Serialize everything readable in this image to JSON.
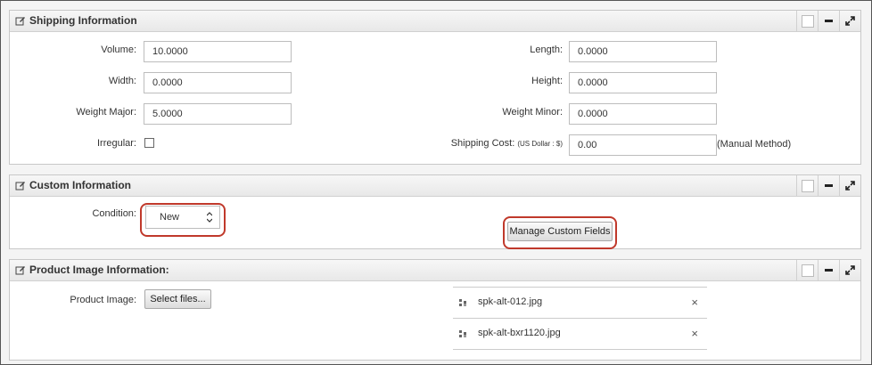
{
  "shipping": {
    "title": "Shipping Information",
    "volume": {
      "label": "Volume:",
      "value": "10.0000"
    },
    "width": {
      "label": "Width:",
      "value": "0.0000"
    },
    "weight_major": {
      "label": "Weight Major:",
      "value": "5.0000"
    },
    "irregular": {
      "label": "Irregular:"
    },
    "length": {
      "label": "Length:",
      "value": "0.0000"
    },
    "height": {
      "label": "Height:",
      "value": "0.0000"
    },
    "weight_minor": {
      "label": "Weight Minor:",
      "value": "0.0000"
    },
    "shipping_cost": {
      "label": "Shipping Cost:",
      "currency": "(US Dollar : $)",
      "value": "0.00",
      "method": "(Manual Method)"
    }
  },
  "custom": {
    "title": "Custom Information",
    "condition": {
      "label": "Condition:",
      "value": "New"
    },
    "manage_button": "Manage Custom Fields"
  },
  "images": {
    "title": "Product Image Information:",
    "product_image_label": "Product Image:",
    "select_button": "Select files...",
    "files": [
      "spk-alt-012.jpg",
      "spk-alt-bxr1120.jpg"
    ],
    "remove_icon": "×"
  },
  "colors": {
    "highlight": "#c0392b"
  }
}
